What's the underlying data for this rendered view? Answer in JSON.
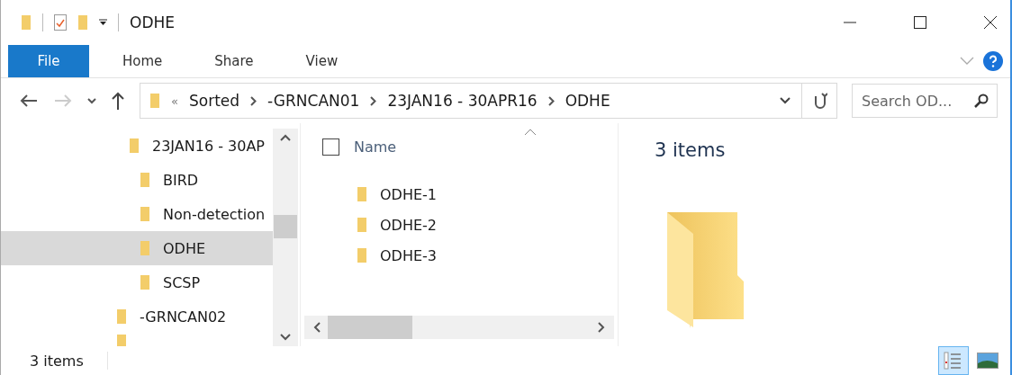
{
  "window": {
    "title": "ODHE"
  },
  "ribbon_tabs": [
    {
      "label": "File",
      "selected": true
    },
    {
      "label": "Home",
      "selected": false
    },
    {
      "label": "Share",
      "selected": false
    },
    {
      "label": "View",
      "selected": false
    }
  ],
  "navigation": {
    "back_enabled": true,
    "forward_enabled": false
  },
  "address": {
    "overflow": "«",
    "crumbs": [
      "Sorted",
      "-GRNCAN01",
      "23JAN16 - 30APR16",
      "ODHE"
    ]
  },
  "search": {
    "placeholder": "Search OD..."
  },
  "nav_tree": [
    {
      "children": [
        {
          "label": "23JAN16 - 30AP",
          "selected": false,
          "children": [
            {
              "label": "BIRD",
              "selected": false
            },
            {
              "label": "Non-detection",
              "selected": false
            },
            {
              "label": "ODHE",
              "selected": true
            },
            {
              "label": "SCSP",
              "selected": false
            }
          ]
        }
      ]
    },
    {
      "label": "-GRNCAN02",
      "selected": false
    }
  ],
  "file_list": {
    "select_all_checked": false,
    "column": "Name",
    "items": [
      "ODHE-1",
      "ODHE-2",
      "ODHE-3"
    ]
  },
  "details_pane": {
    "summary": "3 items"
  },
  "status_bar": {
    "count": "3 items",
    "views": [
      {
        "kind": "details",
        "selected": true
      },
      {
        "kind": "large",
        "selected": false
      }
    ]
  }
}
